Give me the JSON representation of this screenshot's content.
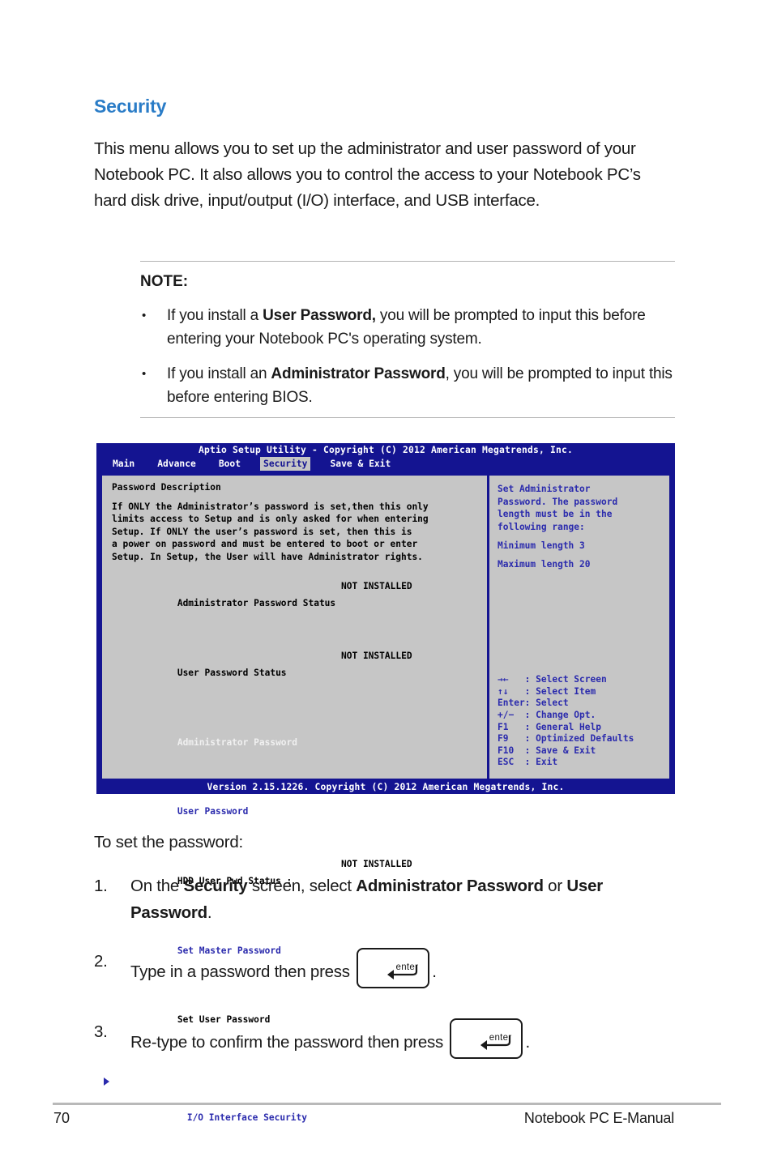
{
  "section": {
    "heading": "Security",
    "intro": "This menu allows you to set up the administrator and user password of your Notebook PC. It also allows you to control the access to your Notebook PC’s hard disk drive, input/output (I/O) interface, and USB interface."
  },
  "note": {
    "title": "NOTE:",
    "bullet_glyph": "•",
    "items": [
      {
        "pre": "If you install a ",
        "bold": "User Password,",
        "post": " you will be prompted to input this before entering your Notebook PC's operating system."
      },
      {
        "pre": "If you install an ",
        "bold": "Administrator Password",
        "post": ", you will be prompted to input this before entering BIOS."
      }
    ]
  },
  "bios": {
    "title": "Aptio Setup Utility - Copyright (C) 2012 American Megatrends, Inc.",
    "tabs": [
      {
        "label": "Main",
        "active": false
      },
      {
        "label": "Advance",
        "active": false
      },
      {
        "label": "Boot",
        "active": false
      },
      {
        "label": "Security",
        "active": true
      },
      {
        "label": "Save & Exit",
        "active": false
      }
    ],
    "left": {
      "description_title": "Password Description",
      "description_body": "If ONLY the Administrator’s password is set,then this only\nlimits access to Setup and is only asked for when entering\nSetup. If ONLY the user’s password is set, then this is\na power on password and must be entered to boot or enter\nSetup. In Setup, the User will have Administrator rights.",
      "rows": [
        {
          "label": "Administrator Password Status",
          "value": "NOT INSTALLED",
          "style": "black"
        },
        {
          "label": "User Password Status",
          "value": "NOT INSTALLED",
          "style": "black"
        },
        {
          "label": "Administrator Password",
          "value": "",
          "style": "white"
        },
        {
          "label": "User Password",
          "value": "",
          "style": "blue"
        },
        {
          "label": "HDD User Pwd Status :",
          "value": "NOT INSTALLED",
          "style": "black"
        },
        {
          "label": "Set Master Password",
          "value": "",
          "style": "blue"
        },
        {
          "label": "Set User Password",
          "value": "",
          "style": "black"
        }
      ],
      "submenu": {
        "label": "I/O Interface Security",
        "marker": "triangle-right-icon"
      }
    },
    "right": {
      "help_text": "Set Administrator\nPassword. The password\nlength must be in the\nfollowing range:",
      "help_min": "Minimum length 3",
      "help_max": "Maximum length 20",
      "keys": [
        {
          "key": "→←",
          "action": ": Select Screen"
        },
        {
          "key": "↑↓",
          "action": ": Select Item"
        },
        {
          "key": "Enter",
          "action": ": Select"
        },
        {
          "key": "+/−",
          "action": ": Change Opt."
        },
        {
          "key": "F1",
          "action": ": General Help"
        },
        {
          "key": "F9",
          "action": ": Optimized Defaults"
        },
        {
          "key": "F10",
          "action": ": Save & Exit"
        },
        {
          "key": "ESC",
          "action": ": Exit"
        }
      ],
      "keys_block": "→←   : Select Screen\n↑↓   : Select Item\nEnter: Select\n+/−  : Change Opt.\nF1   : General Help\nF9   : Optimized Defaults\nF10  : Save & Exit\nESC  : Exit"
    },
    "version": "Version 2.15.1226. Copyright (C) 2012 American Megatrends, Inc.",
    "colors": {
      "chrome_blue": "#141491",
      "panel_gray": "#c6c6c6",
      "blue_text": "#2b2bad",
      "active_tab_bg": "#c6c6c6"
    }
  },
  "procedure": {
    "lead": "To set the password:",
    "steps": [
      {
        "num": "1.",
        "pre": "On the ",
        "bold1": "Security",
        "mid": " screen, select ",
        "bold2": "Administrator Password",
        "mid2": " or ",
        "bold3": "User Password",
        "post": "."
      },
      {
        "num": "2.",
        "pre": "Type in a password then press ",
        "post": "."
      },
      {
        "num": "3.",
        "pre": "Re-type to confirm the password then press ",
        "post": "."
      }
    ],
    "enter_key_label": "enter"
  },
  "footer": {
    "page_number": "70",
    "manual_name": "Notebook PC E-Manual"
  }
}
